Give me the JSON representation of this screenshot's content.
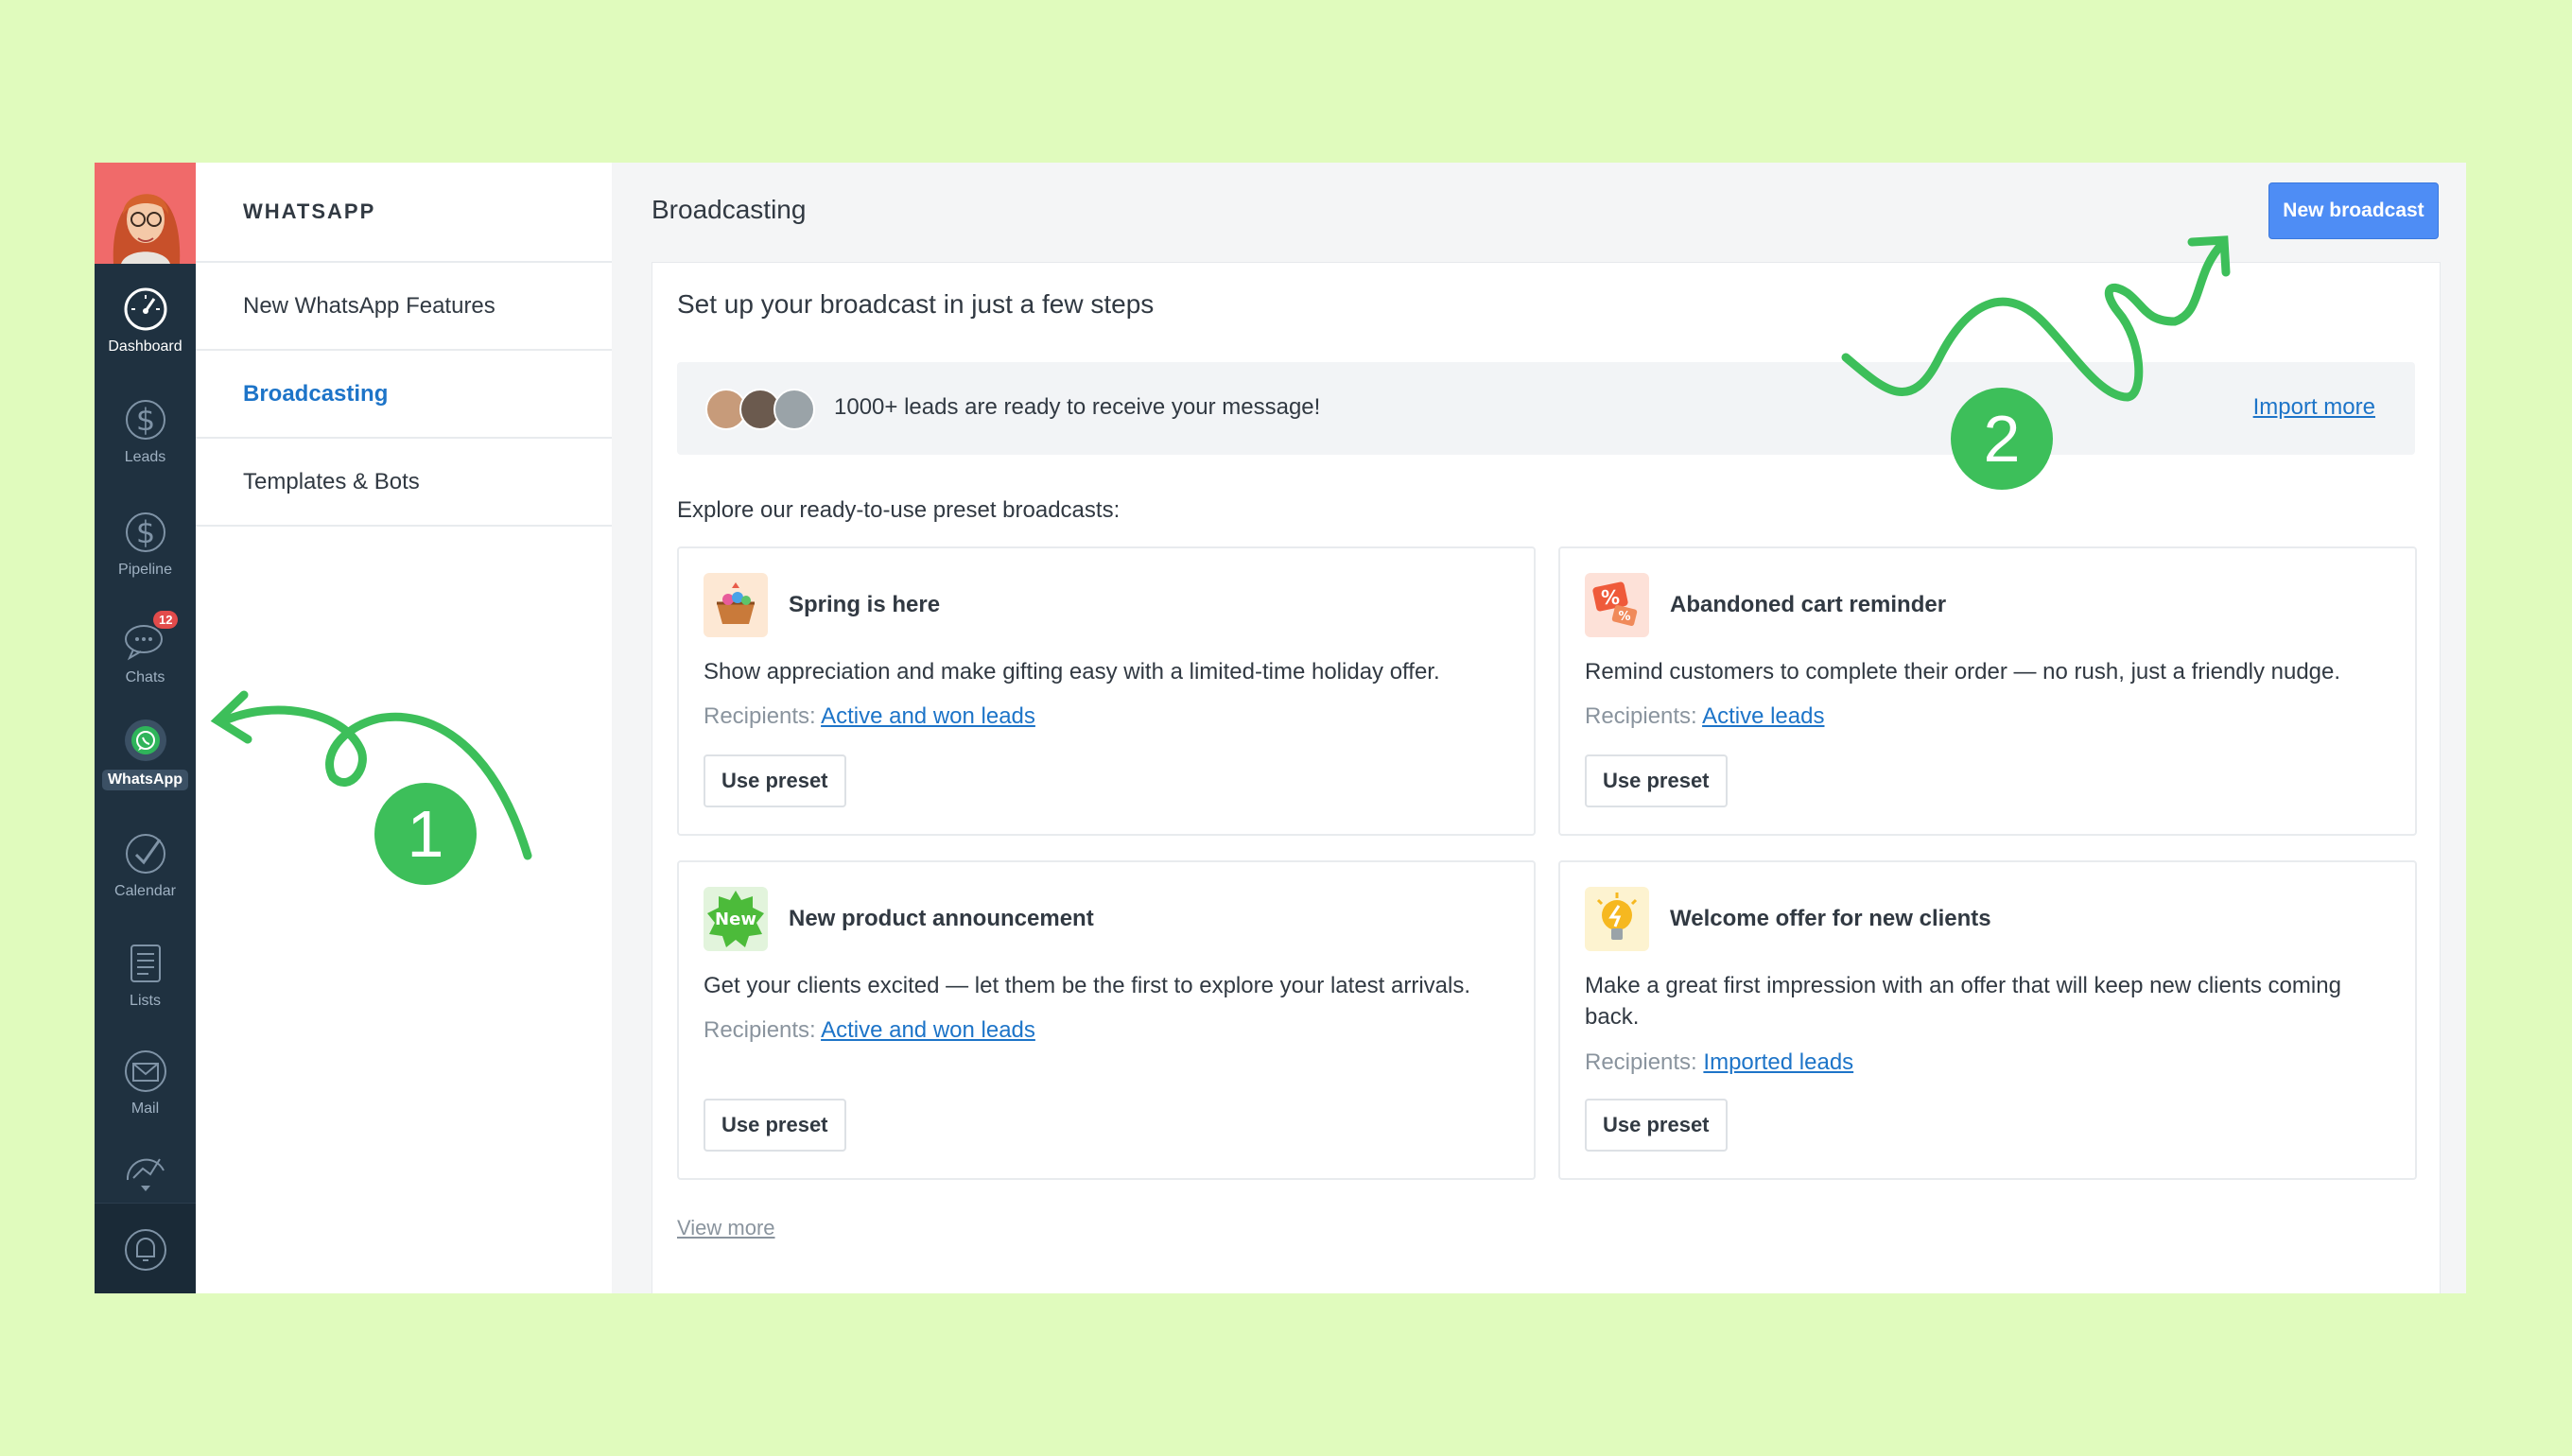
{
  "sidebar": {
    "items": [
      {
        "label": "Dashboard",
        "icon": "speedometer-icon"
      },
      {
        "label": "Leads",
        "icon": "dollar-icon"
      },
      {
        "label": "Pipeline",
        "icon": "dollar-icon"
      },
      {
        "label": "Chats",
        "icon": "chat-bubbles-icon",
        "badge": "12"
      },
      {
        "label": "WhatsApp",
        "icon": "whatsapp-icon"
      },
      {
        "label": "Calendar",
        "icon": "check-circle-icon"
      },
      {
        "label": "Lists",
        "icon": "list-icon"
      },
      {
        "label": "Mail",
        "icon": "mail-icon"
      }
    ]
  },
  "subnav": {
    "title": "WHATSAPP",
    "items": [
      "New WhatsApp Features",
      "Broadcasting",
      "Templates & Bots"
    ],
    "active": "Broadcasting"
  },
  "header": {
    "title": "Broadcasting",
    "new_broadcast_label": "New broadcast"
  },
  "main": {
    "setup_title": "Set up your broadcast in just a few steps",
    "leads_message": "1000+ leads are ready to receive your message!",
    "import_more": "Import more",
    "explore_label": "Explore our ready-to-use preset broadcasts:",
    "recipients_label": "Recipients:",
    "use_preset_label": "Use preset",
    "view_more": "View more",
    "presets": [
      {
        "title": "Spring is here",
        "description": "Show appreciation and make gifting easy with a limited-time holiday offer.",
        "recipients": "Active and won leads",
        "icon": "basket-icon"
      },
      {
        "title": "Abandoned cart reminder",
        "description": "Remind customers to complete their order — no rush, just a friendly nudge.",
        "recipients": "Active leads",
        "icon": "discount-tag-icon"
      },
      {
        "title": "New product announcement",
        "description": "Get your clients excited — let them be the first to explore your latest arrivals.",
        "recipients": "Active and won leads",
        "icon": "new-badge-icon",
        "badge_text": "New"
      },
      {
        "title": "Welcome offer for new clients",
        "description": "Make a great first impression with an offer that will keep new clients coming back.",
        "recipients": "Imported leads",
        "icon": "lightbulb-icon"
      }
    ]
  },
  "annotations": {
    "step1": "1",
    "step2": "2"
  },
  "colors": {
    "background": "#e0fbbd",
    "accent": "#4e8df5",
    "link": "#1d74c8",
    "annotation": "#3dbf5a",
    "rail": "#1f3140"
  }
}
